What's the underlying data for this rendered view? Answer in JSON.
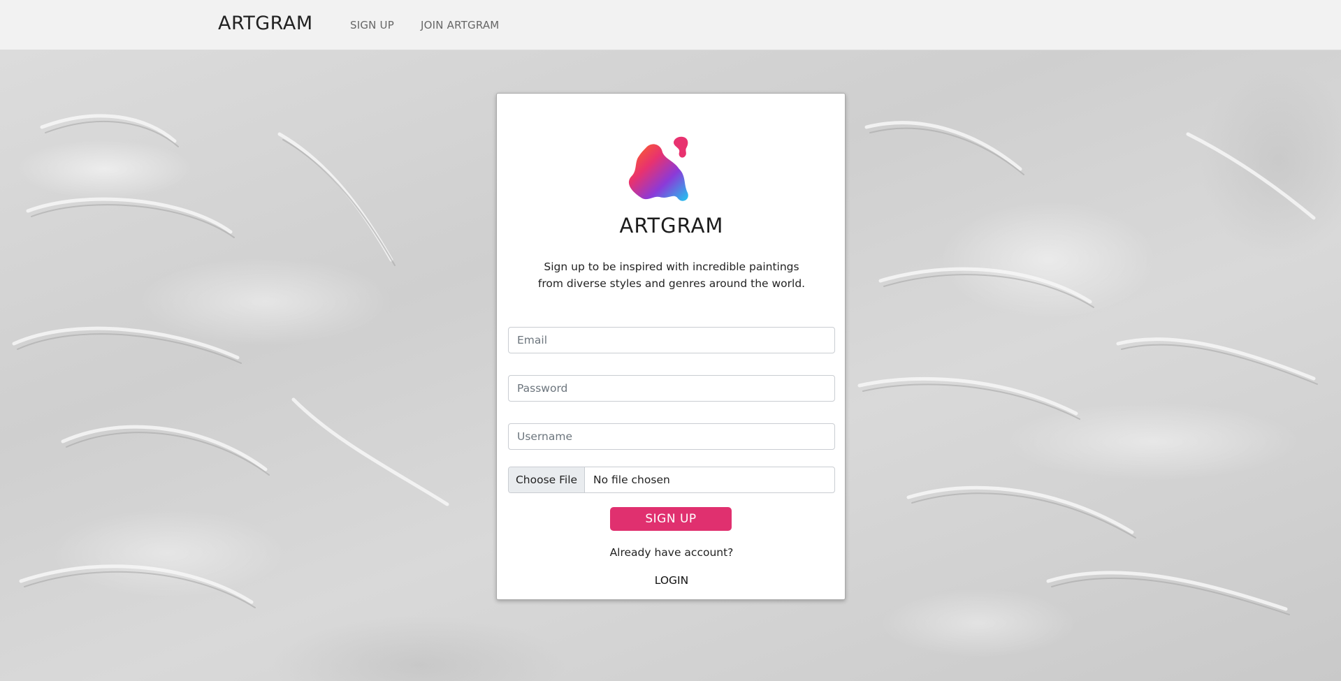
{
  "navbar": {
    "brand": "ARTGRAM",
    "links": [
      {
        "label": "SIGN UP"
      },
      {
        "label": "JOIN ARTGRAM"
      }
    ]
  },
  "card": {
    "logo_icon": "paint-blob-logo-icon",
    "logo_text": "ARTGRAM",
    "tagline_line1": "Sign up to be inspired with incredible paintings",
    "tagline_line2": "from diverse styles and genres around the world.",
    "fields": {
      "email_placeholder": "Email",
      "password_placeholder": "Password",
      "username_placeholder": "Username"
    },
    "file": {
      "button_label": "Choose File",
      "status": "No file chosen"
    },
    "submit_label": "SIGN UP",
    "already_text": "Already have account?",
    "login_label": "LOGIN"
  },
  "colors": {
    "accent": "#e0306f",
    "navbar_bg": "#f2f2f2",
    "card_bg": "#ffffff"
  }
}
